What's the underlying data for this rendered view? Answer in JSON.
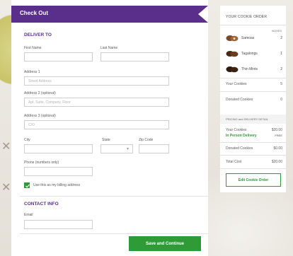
{
  "checkout": {
    "title": "Check Out",
    "deliver_section": "DELIVER TO",
    "first_name_label": "First Name",
    "last_name_label": "Last Name",
    "address1_label": "Address 1",
    "address1_placeholder": "Street Address",
    "address2_label": "Address 2 (optional)",
    "address2_placeholder": "Apt, Suite, Company, Floor",
    "address3_label": "Address 3 (optional)",
    "address3_placeholder": "C/O",
    "city_label": "City",
    "state_label": "State",
    "zip_label": "Zip Code",
    "phone_label": "Phone (numbers only)",
    "billing_checkbox_label": "Use this as my billing address",
    "contact_section": "CONTACT INFO",
    "email_label": "Email",
    "save_button": "Save and Continue"
  },
  "order": {
    "title": "YOUR COOKIE ORDER",
    "boxes_header": "BOXES",
    "items": [
      {
        "name": "Samoas",
        "qty": "2"
      },
      {
        "name": "Tagalongs",
        "qty": "1"
      },
      {
        "name": "Thin Mints",
        "qty": "2"
      }
    ],
    "your_cookies_label": "Your Cookies",
    "your_cookies_value": "5",
    "donated_label": "Donated Cookies",
    "donated_value": "0",
    "shipping_band": "PRICING and DELIVERY DETAIL",
    "price_your_cookies_label": "Your Cookies",
    "price_your_cookies_value": "$20.00",
    "delivery_label": "In Person Delivery",
    "delivery_value": "FREE",
    "price_donated_label": "Donated Cookies",
    "price_donated_value": "$0.00",
    "total_label": "Total Cost",
    "total_value": "$20.00",
    "edit_button": "Edit Cookie Order"
  },
  "colors": {
    "brand_purple": "#5a2f8c",
    "accent_green": "#2e9b36"
  }
}
